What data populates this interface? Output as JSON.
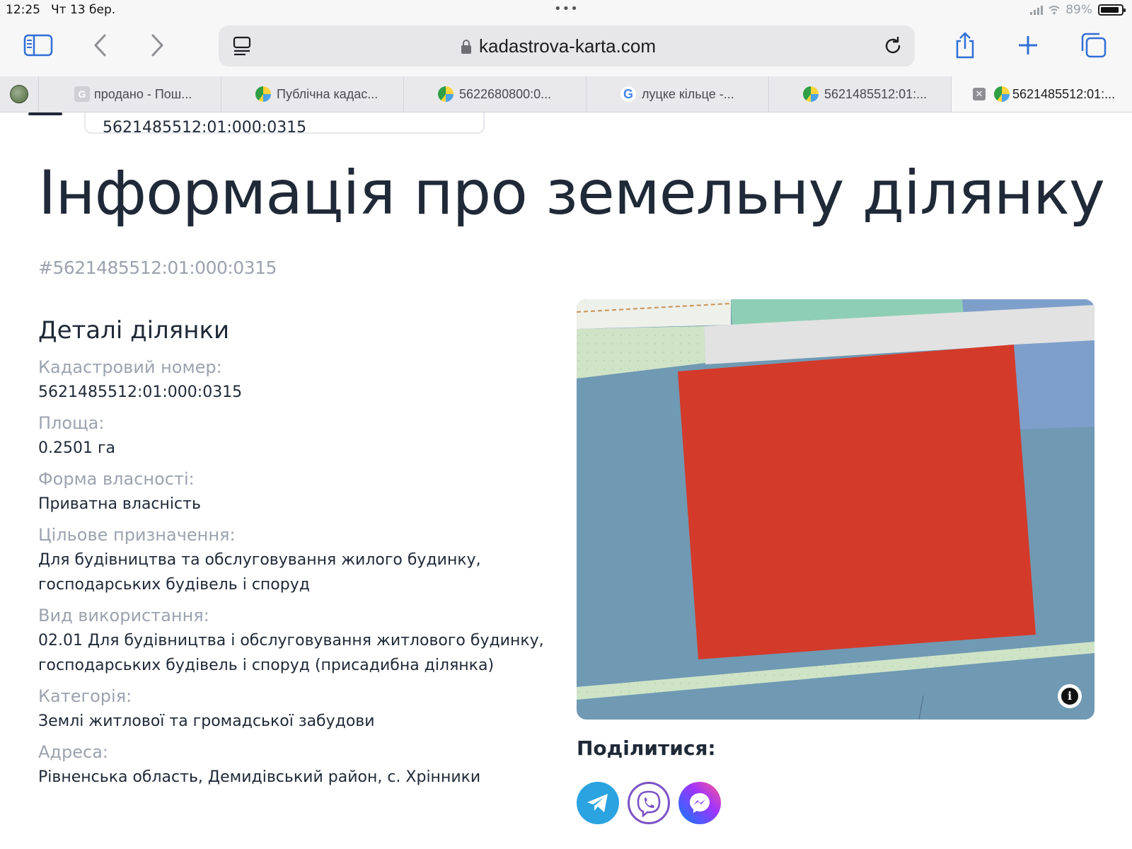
{
  "status_bar": {
    "time": "12:25",
    "date": "Чт 13 бер.",
    "battery": "89%",
    "battery_level": 0.89
  },
  "browser": {
    "url": "kadastrova-karta.com",
    "tabs": [
      {
        "title": "продано - Пош...",
        "favicon": "gray-g-icon"
      },
      {
        "title": "Публічна кадас...",
        "favicon": "map-favicon"
      },
      {
        "title": "5622680800:0...",
        "favicon": "map-favicon"
      },
      {
        "title": "луцке кільце -...",
        "favicon": "google-icon"
      },
      {
        "title": "5621485512:01:...",
        "favicon": "map-favicon"
      },
      {
        "title": "5621485512:01:...",
        "favicon": "map-favicon",
        "active": true
      }
    ],
    "google_letter": "G",
    "close_glyph": "✕"
  },
  "page": {
    "search_value": "5621485512:01:000:0315",
    "title": "Інформація про земельну ділянку",
    "cadastral_hash": "#5621485512:01:000:0315",
    "details": {
      "heading": "Деталі ділянки",
      "items": [
        {
          "label": "Кадастровий номер:",
          "value": "5621485512:01:000:0315"
        },
        {
          "label": "Площа:",
          "value": "0.2501 га"
        },
        {
          "label": "Форма власності:",
          "value": "Приватна власність"
        },
        {
          "label": "Цільове призначення:",
          "value": "Для будівництва та обслуговування жилого будинку, господарських будівель і споруд"
        },
        {
          "label": "Вид використання:",
          "value": "02.01 Для будівництва і обслуговування житлового будинку, господарських будівель і споруд (присадибна ділянка)"
        },
        {
          "label": "Категорія:",
          "value": "Землі житлової та громадської забудови"
        },
        {
          "label": "Адреса:",
          "value": "Рівненська область, Демидівський район, с. Хрінники"
        }
      ]
    },
    "map": {
      "info_glyph": "i",
      "colors": {
        "parcel": "#d43a2a",
        "background": "#7099b3",
        "road": "#e2e2e2",
        "green": "#cfe4c7",
        "teal": "#8fceb6",
        "blue": "#7f9fcb"
      }
    },
    "share": {
      "title": "Поділитися:",
      "buttons": [
        "telegram-icon",
        "viber-icon",
        "messenger-icon"
      ]
    }
  },
  "colors": {
    "accent": "#2f6fd6",
    "text": "#1f2937",
    "muted": "#9ca3af"
  }
}
